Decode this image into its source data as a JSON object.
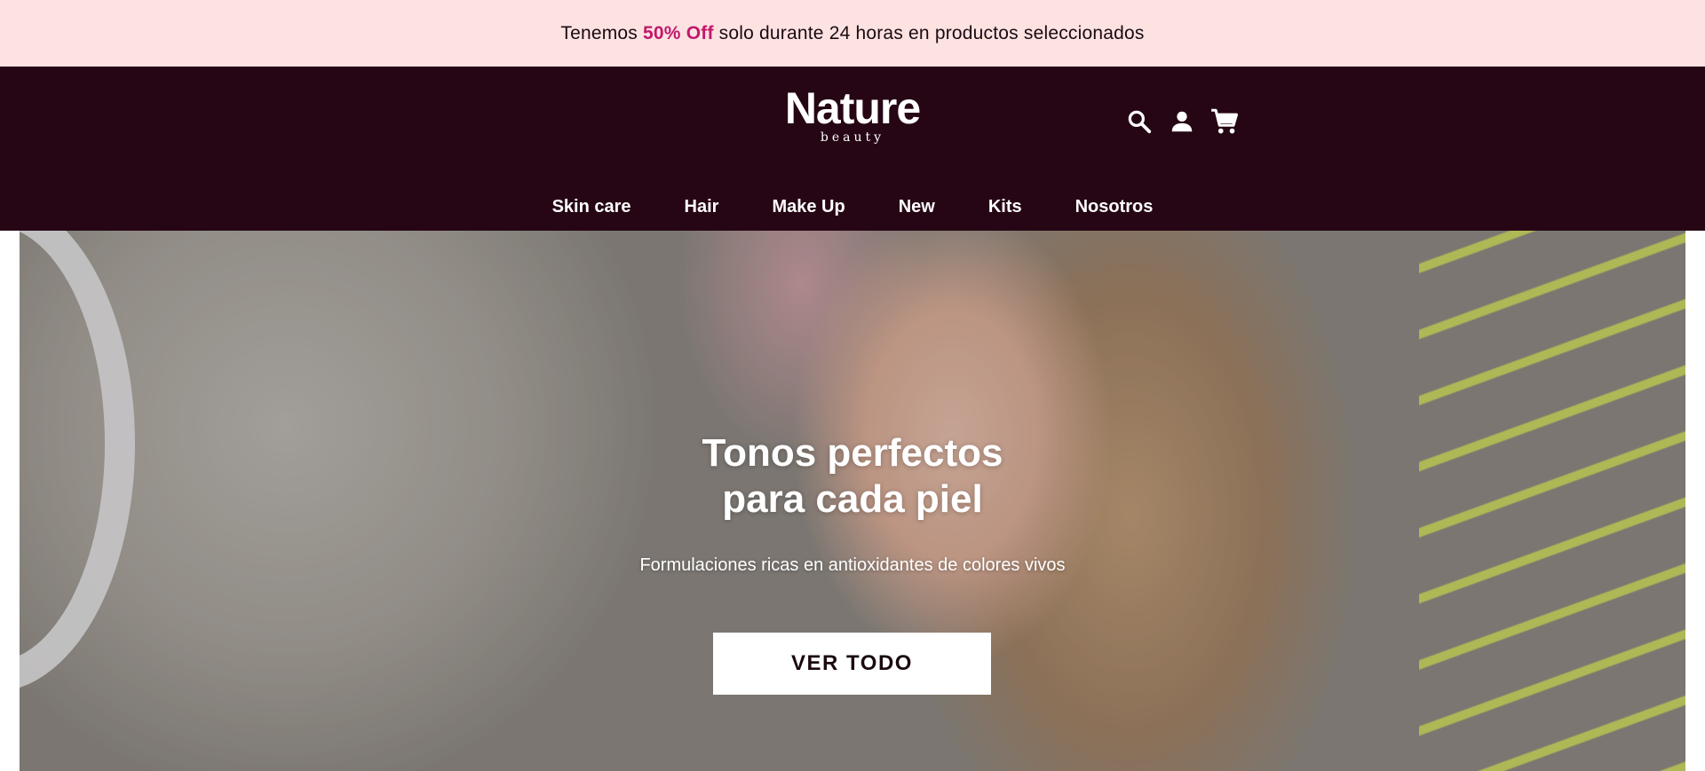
{
  "promo": {
    "prefix": "Tenemos ",
    "highlight": "50% Off",
    "suffix": " solo durante 24 horas en productos seleccionados",
    "highlight_color": "#c2186b",
    "background": "#fde2e2"
  },
  "header": {
    "background": "#260615",
    "logo": {
      "main": "Nature",
      "sub": "beauty"
    },
    "icons": [
      "search-icon",
      "user-icon",
      "cart-icon"
    ]
  },
  "nav": {
    "items": [
      {
        "label": "Skin care"
      },
      {
        "label": "Hair"
      },
      {
        "label": "Make Up"
      },
      {
        "label": "New"
      },
      {
        "label": "Kits"
      },
      {
        "label": "Nosotros"
      }
    ]
  },
  "hero": {
    "title_line1": "Tonos perfectos",
    "title_line2": "para cada piel",
    "subtitle": "Formulaciones ricas en antioxidantes de colores vivos",
    "cta_label": "VER TODO"
  }
}
